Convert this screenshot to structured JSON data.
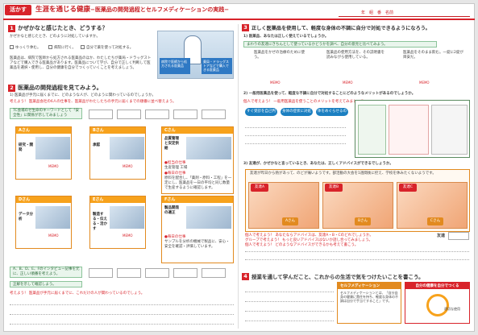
{
  "header": {
    "tag": "活かす",
    "title": "生涯を通じる健康",
    "subtitle": "−医薬品の開発過程とセルフメディケーションの実践−",
    "name_label": "年　組　番　名前"
  },
  "s1": {
    "num": "1",
    "question": "かぜかなと感じたとき、どうする？",
    "prompt": "かぜかなと感じたとき、どのように対処していますか。",
    "options": [
      "ゆっくり休む。",
      "病院に行く。",
      "自分で薬を使って対処する。"
    ],
    "body": "医薬品は、病院で医師から処方される医薬品のほか、わたしたちが薬局・ドラッグストアなどで購入できる医薬品があります。医薬品について学び、自分で正しく判断して医薬品を選択・使用し、自分の健康を自分でつくっていくことを考えましょう。",
    "callout_a": "病院で医師から処方される医薬品",
    "callout_b": "薬局・ドラッグストアなどで購入できる医薬品"
  },
  "s2": {
    "num": "2",
    "question": "医薬品の開発過程を見てみよう。",
    "prompt": "1) 医薬品が手元に届くまでに、どのような人が、どのように関わっているのでしょうか。",
    "hint": "考えよう！ 医薬品会社の6人の仕事を、医薬品がわたしたちの手元に届くまでの順番に並べ替えよう。",
    "check": "TC会場のせ生命のキーワードとして「安全性」に関係が示してみましょう",
    "cards": [
      {
        "head": "Aさん",
        "label": "研究・開発"
      },
      {
        "head": "Bさん",
        "label": "承認"
      },
      {
        "head": "Cさん",
        "label": "品質管理と安定供給"
      },
      {
        "head": "Dさん",
        "label": "データ分析"
      },
      {
        "head": "Eさん",
        "label": "製造する・伝える・活かす"
      },
      {
        "head": "Fさん",
        "label": "製品開発の適正"
      }
    ],
    "memo": "MEMO",
    "c_job": "●担当の仕事",
    "c_job_txt": "生産管理 工場",
    "c_day": "●毎日の仕事",
    "c_day_txt": "原料を配合し、「薬剤・原料・工程」を一定にし、医薬品を一日の平均と同じ数量で生産するように確認します。",
    "f_day": "●毎日の仕事",
    "f_day_txt": "サンプルを分析の機械で製品に、安心・安全を確認・評価しています。",
    "bottom_prompt": "A、B、D、E、Fのインタビュー記事を元に、正しい順番を考えよう。",
    "bottom_hint": "正解を示して確認しよう。",
    "bottom_q": "考えよう！ 医薬品が手元に届くまでに、これだけの人が関わっているのでしょう。"
  },
  "s3": {
    "num": "3",
    "question": "正しく医薬品を使用して、軽度な身体の不調に自分で対処できるようになろう。",
    "q1": "1) 医薬品、あなたは正しく使えているでしょうか。",
    "q1_hint": "まわりの友達にきちんとして使っているかどうかを調べ、自分の意見と比べてみよう。",
    "q1_opts": [
      "医薬品をかぜの治療のために使う。",
      "医薬品の使用方法を、その説明書を読みながら使用している。",
      "医薬品をそのまま飲む。一錠に2錠が目安だ。"
    ],
    "memo": "MEMO",
    "q2": "2) 一般用医薬品を使って、軽度な不調に自分で対処することにどのようなメリットがあるのでしょうか。",
    "q2_hint": "個人で考えよう！ 一般用医薬品を使うことのメリットを考えてみましょう。",
    "pills": [
      "すぐ受診を自己判断できる",
      "身体の症状に対処できる",
      "体をめぐらせるのに役立てる"
    ],
    "q3": "3) 友達が、かぜかなと言っているとき、あなたは、正しくアドバイスができるでしょうか。",
    "q3_intro": "友達が昨日から熱があって、のどが痛いようです。部活動の大会を1週間後に控え、学校を休みたくないようです。",
    "persons": [
      {
        "label": "友達A",
        "tag": "Aさん"
      },
      {
        "label": "友達B",
        "tag": "Bさん"
      },
      {
        "label": "友達C",
        "tag": "Cさん"
      }
    ],
    "q3_a": "個人で考えよう！ あなたならアドバイスは、友達A・B・Cのどれでしょうか。",
    "q3_b": "グループで考えよう！ もっと良いアドバイスはないか話し合ってみましょう。",
    "q3_c": "個人で考えよう！ どのようなアドバイスができるかも考えて書こう。",
    "friend_label": "友達"
  },
  "s4": {
    "num": "4",
    "question": "授業を通して学んだこと、これからの生活で気をつけたいことを書こう。",
    "self_head": "セルフメディケーション",
    "self_text": "セルフメディケーションとは、「自分自身の健康に責任を持ち、軽度な身体の不調は自分で手当てすること」です。",
    "diagram_head": "自分の健康を自分でつくる",
    "diagram_item": "適切な使用"
  }
}
